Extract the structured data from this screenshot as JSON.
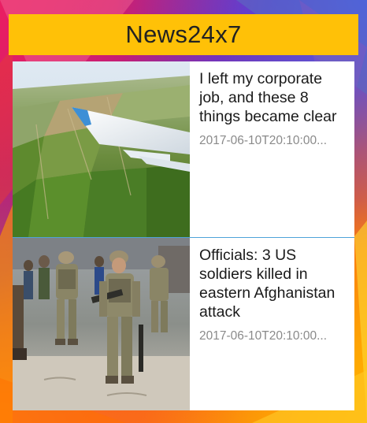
{
  "app": {
    "title": "News24x7"
  },
  "colors": {
    "app_bar": "#ffc107",
    "divider": "#4fa3d9",
    "timestamp": "#8a8a8a"
  },
  "articles": [
    {
      "headline": "I left my corporate job, and these 8 things became clear",
      "timestamp": "2017-06-10T20:10:00...",
      "thumbnail_icon": "airplane-wing-photo"
    },
    {
      "headline": "Officials: 3 US soldiers killed in eastern Afghanistan attack",
      "timestamp": "2017-06-10T20:10:00...",
      "thumbnail_icon": "soldiers-photo"
    }
  ]
}
